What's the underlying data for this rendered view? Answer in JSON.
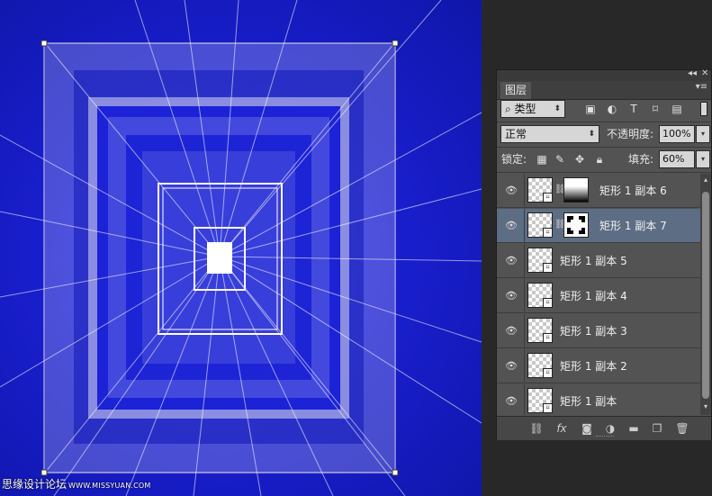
{
  "panel": {
    "collapse_icon": "double-left-arrow-icon",
    "close_icon": "close-x-icon",
    "tab_label": "图层",
    "menu_icon": "panel-menu-icon"
  },
  "filter": {
    "kind_label": "类型",
    "icons": [
      "image-filter-icon",
      "adjustment-filter-icon",
      "type-filter-icon",
      "shape-filter-icon",
      "smart-object-filter-icon"
    ]
  },
  "blend": {
    "mode": "正常",
    "opacity_label": "不透明度:",
    "opacity_value": "100%"
  },
  "lock": {
    "label": "锁定:",
    "icons": [
      "lock-transparent-icon",
      "lock-paint-icon",
      "lock-position-icon",
      "lock-all-icon"
    ],
    "fill_label": "填充:",
    "fill_value": "60%"
  },
  "layers": [
    {
      "name": "矩形 1 副本 6",
      "mask": "gradient",
      "selected": false
    },
    {
      "name": "矩形 1 副本 7",
      "mask": "corners",
      "selected": true
    },
    {
      "name": "矩形 1 副本 5",
      "mask": "none",
      "selected": false
    },
    {
      "name": "矩形 1 副本 4",
      "mask": "none",
      "selected": false
    },
    {
      "name": "矩形 1 副本 3",
      "mask": "none",
      "selected": false
    },
    {
      "name": "矩形 1 副本 2",
      "mask": "none",
      "selected": false
    },
    {
      "name": "矩形 1 副本",
      "mask": "none",
      "selected": false
    }
  ],
  "footer_icons": [
    "link-layers-icon",
    "fx-icon",
    "add-mask-icon",
    "adjustment-layer-icon",
    "new-group-icon",
    "new-layer-icon",
    "trash-icon"
  ],
  "watermark": {
    "text": "思缘设计论坛",
    "url": "WWW.MISSYUAN.COM"
  },
  "colors": {
    "canvas_blue": "#1a1fd0",
    "panel_bg": "#535353",
    "selected_row": "#5c6d84"
  }
}
